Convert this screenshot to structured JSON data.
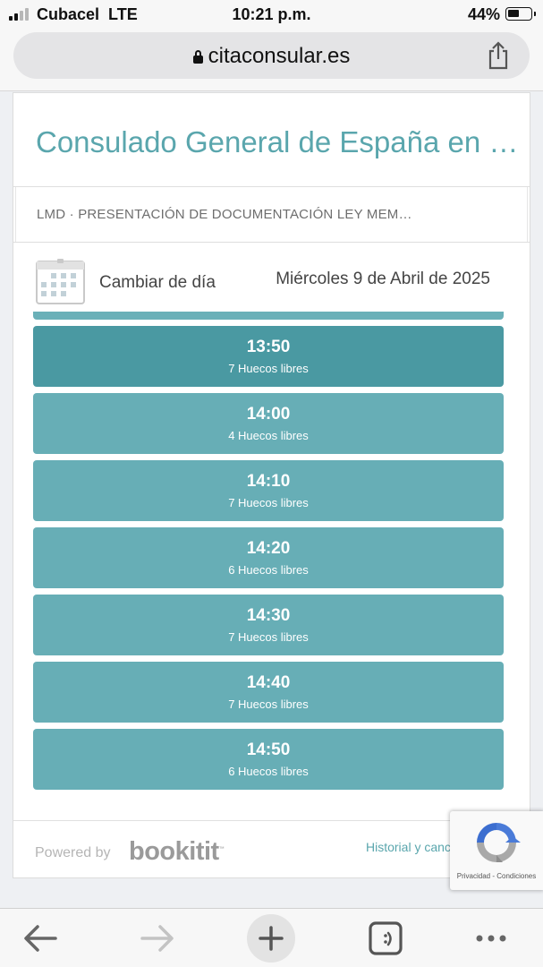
{
  "status_bar": {
    "carrier": "Cubacel",
    "network": "LTE",
    "time": "10:21 p.m.",
    "battery": "44%",
    "battery_level": 0.44
  },
  "browser": {
    "url": "citaconsular.es"
  },
  "page": {
    "title": "Consulado General de España en …",
    "service": "LMD · PRESENTACIÓN DE DOCUMENTACIÓN LEY MEM…",
    "change_day": "Cambiar de día",
    "date": "Miércoles 9 de Abril de 2025",
    "slots": [
      {
        "time": "13:50",
        "free": "7 Huecos libres",
        "selected": true
      },
      {
        "time": "14:00",
        "free": "4 Huecos libres",
        "selected": false
      },
      {
        "time": "14:10",
        "free": "7 Huecos libres",
        "selected": false
      },
      {
        "time": "14:20",
        "free": "6 Huecos libres",
        "selected": false
      },
      {
        "time": "14:30",
        "free": "7 Huecos libres",
        "selected": false
      },
      {
        "time": "14:40",
        "free": "7 Huecos libres",
        "selected": false
      },
      {
        "time": "14:50",
        "free": "6 Huecos libres",
        "selected": false
      }
    ],
    "footer": {
      "powered_by": "Powered by",
      "logo_text": "bookitit",
      "logo_tm": "™",
      "history_link": "Historial y canc"
    }
  },
  "recaptcha": {
    "links": "Privacidad - Condiciones"
  },
  "toolbar": {
    "icons": [
      "back-arrow-icon",
      "forward-arrow-icon",
      "plus-icon",
      "tabs-icon",
      "more-icon"
    ]
  },
  "colors": {
    "accent": "#5aa6ad",
    "slot": "#67aeb6",
    "slot_selected": "#4a99a2"
  }
}
